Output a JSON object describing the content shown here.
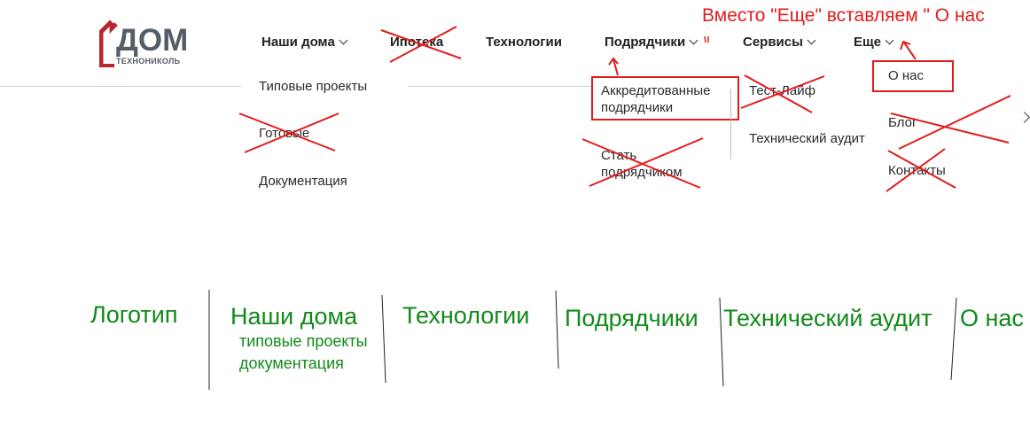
{
  "logo": {
    "word": "ДОМ",
    "sub": "ТЕХНОНИКОЛЬ"
  },
  "nav": {
    "houses": "Наши дома",
    "mortgage": "Ипотека",
    "technologies": "Технологии",
    "contractors": "Подрядчики",
    "services": "Сервисы",
    "more": "Еще"
  },
  "submenu_houses": [
    "Типовые проекты",
    "Готовые",
    "Документация"
  ],
  "submenu_contractors": {
    "accredited": "Аккредитованные подрядчики",
    "become": "Стать подрядчиком"
  },
  "submenu_services": [
    "Тест-Лайф",
    "Технический аудит"
  ],
  "submenu_more": [
    "О нас",
    "Блог",
    "Контакты"
  ],
  "annotation": "Вместо \"Еще\" вставляем \" О нас",
  "plan": {
    "logo": "Логотип",
    "houses": "Наши дома",
    "houses_sub": [
      "типовые проекты",
      "документация"
    ],
    "technologies": "Технологии",
    "contractors": "Подрядчики",
    "audit": "Технический аудит",
    "about": "О нас"
  },
  "colors": {
    "annotation_red": "#e21b1b",
    "plan_green": "#118a1a",
    "logo_red": "#b8272d",
    "logo_gray": "#545d68"
  }
}
